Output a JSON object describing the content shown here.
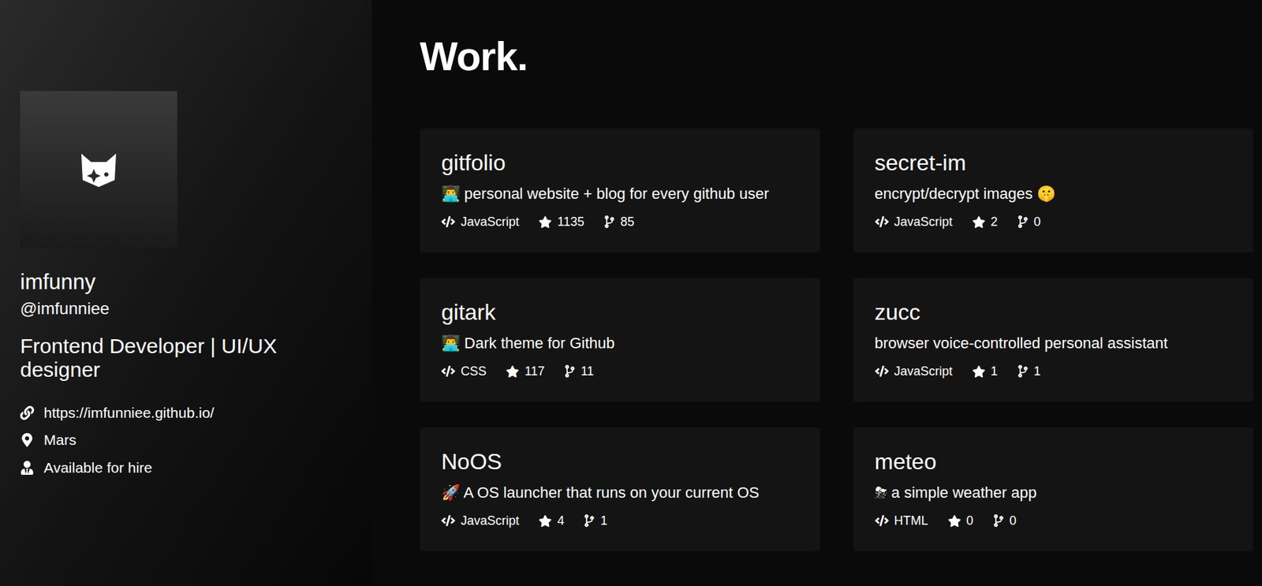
{
  "profile": {
    "name": "imfunny",
    "handle": "@imfunniee",
    "bio": "Frontend Developer | UI/UX designer",
    "website": "https://imfunniee.github.io/",
    "location": "Mars",
    "hire": "Available for hire"
  },
  "heading": "Work.",
  "columns": [
    [
      {
        "title": "gitfolio",
        "description": "👨‍💻 personal website + blog for every github user",
        "language": "JavaScript",
        "stars": "1135",
        "forks": "85"
      },
      {
        "title": "gitark",
        "description": "👨‍💻 Dark theme for Github",
        "language": "CSS",
        "stars": "117",
        "forks": "11"
      },
      {
        "title": "NoOS",
        "description": "🚀 A OS launcher that runs on your current OS",
        "language": "JavaScript",
        "stars": "4",
        "forks": "1"
      }
    ],
    [
      {
        "title": "secret-im",
        "description": "encrypt/decrypt images 🤫",
        "language": "JavaScript",
        "stars": "2",
        "forks": "0"
      },
      {
        "title": "zucc",
        "description": "browser voice-controlled personal assistant",
        "language": "JavaScript",
        "stars": "1",
        "forks": "1"
      },
      {
        "title": "meteo",
        "description": "⛈ a simple weather app",
        "language": "HTML",
        "stars": "0",
        "forks": "0"
      }
    ]
  ]
}
